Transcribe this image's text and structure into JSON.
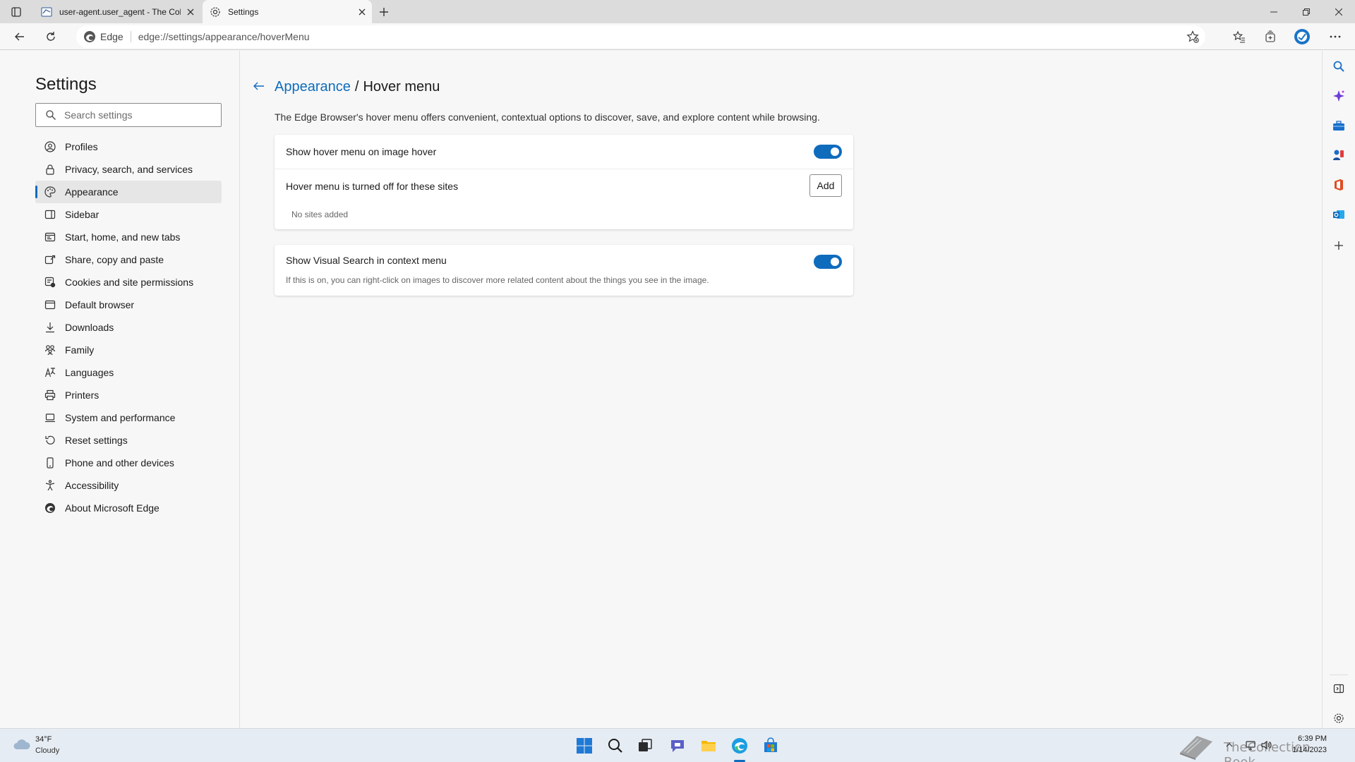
{
  "browser": {
    "tabs": [
      {
        "title": "user-agent.user_agent - The Col"
      },
      {
        "title": "Settings"
      }
    ],
    "address": {
      "edge_label": "Edge",
      "url": "edge://settings/appearance/hoverMenu"
    }
  },
  "nav": {
    "title": "Settings",
    "search_placeholder": "Search settings",
    "items": [
      {
        "label": "Profiles",
        "icon": "profile-icon"
      },
      {
        "label": "Privacy, search, and services",
        "icon": "lock-icon"
      },
      {
        "label": "Appearance",
        "icon": "palette-icon",
        "selected": true
      },
      {
        "label": "Sidebar",
        "icon": "sidebar-icon"
      },
      {
        "label": "Start, home, and new tabs",
        "icon": "home-tabs-icon"
      },
      {
        "label": "Share, copy and paste",
        "icon": "share-icon"
      },
      {
        "label": "Cookies and site permissions",
        "icon": "cookies-icon"
      },
      {
        "label": "Default browser",
        "icon": "browser-icon"
      },
      {
        "label": "Downloads",
        "icon": "download-icon"
      },
      {
        "label": "Family",
        "icon": "family-icon"
      },
      {
        "label": "Languages",
        "icon": "language-icon"
      },
      {
        "label": "Printers",
        "icon": "printer-icon"
      },
      {
        "label": "System and performance",
        "icon": "laptop-icon"
      },
      {
        "label": "Reset settings",
        "icon": "reset-icon"
      },
      {
        "label": "Phone and other devices",
        "icon": "phone-icon"
      },
      {
        "label": "Accessibility",
        "icon": "accessibility-icon"
      },
      {
        "label": "About Microsoft Edge",
        "icon": "edge-icon"
      }
    ]
  },
  "main": {
    "breadcrumb_parent": "Appearance",
    "breadcrumb_sep": "/",
    "breadcrumb_current": "Hover menu",
    "description": "The Edge Browser's hover menu offers convenient, contextual options to discover, save, and explore content while browsing.",
    "hover_toggle_label": "Show hover menu on image hover",
    "hover_toggle_on": true,
    "sites_label": "Hover menu is turned off for these sites",
    "add_label": "Add",
    "no_sites": "No sites added",
    "visual_search_label": "Show Visual Search in context menu",
    "visual_search_on": true,
    "visual_search_desc": "If this is on, you can right-click on images to discover more related content about the things you see in the image."
  },
  "taskbar": {
    "temperature": "34°F",
    "condition": "Cloudy",
    "time": "6:39 PM",
    "date": "1/14/2023",
    "watermark": "TheCollection Book"
  },
  "colors": {
    "accent": "#0f6cbd",
    "toggle_on": "#0f6cbd"
  }
}
